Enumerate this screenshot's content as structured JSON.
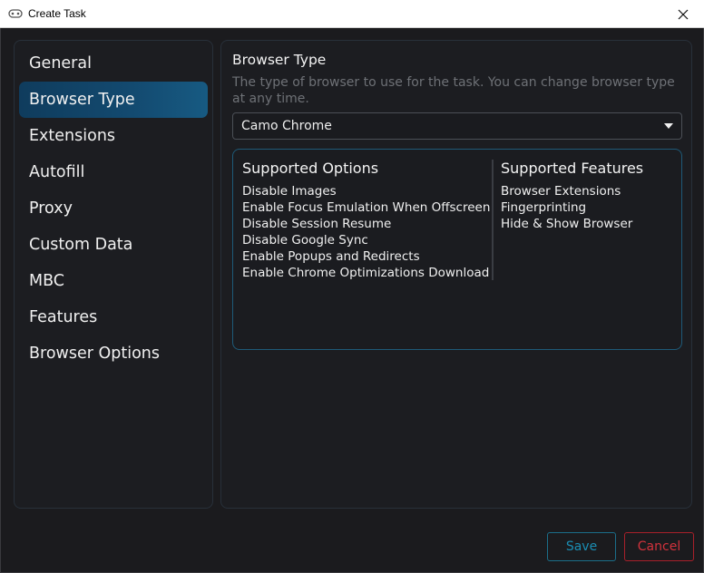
{
  "window": {
    "title": "Create Task",
    "icon": "controller-icon"
  },
  "sidebar": {
    "items": [
      {
        "label": "General",
        "active": false
      },
      {
        "label": "Browser Type",
        "active": true
      },
      {
        "label": "Extensions",
        "active": false
      },
      {
        "label": "Autofill",
        "active": false
      },
      {
        "label": "Proxy",
        "active": false
      },
      {
        "label": "Custom Data",
        "active": false
      },
      {
        "label": "MBC",
        "active": false
      },
      {
        "label": "Features",
        "active": false
      },
      {
        "label": "Browser Options",
        "active": false
      }
    ]
  },
  "main": {
    "title": "Browser Type",
    "description": "The type of browser to use for the task. You can change browser type at any time.",
    "browser_select": {
      "value": "Camo Chrome"
    },
    "supported_options": {
      "title": "Supported Options",
      "items": [
        "Disable Images",
        "Enable Focus Emulation When Offscreen",
        "Disable Session Resume",
        "Disable Google Sync",
        "Enable Popups and Redirects",
        "Enable Chrome Optimizations Download"
      ]
    },
    "supported_features": {
      "title": "Supported Features",
      "items": [
        "Browser Extensions",
        "Fingerprinting",
        "Hide & Show Browser"
      ]
    }
  },
  "footer": {
    "save_label": "Save",
    "cancel_label": "Cancel"
  },
  "colors": {
    "accent": "#175a82",
    "save": "#1b8db3",
    "cancel": "#d3323c",
    "background": "#1b1b1e"
  }
}
